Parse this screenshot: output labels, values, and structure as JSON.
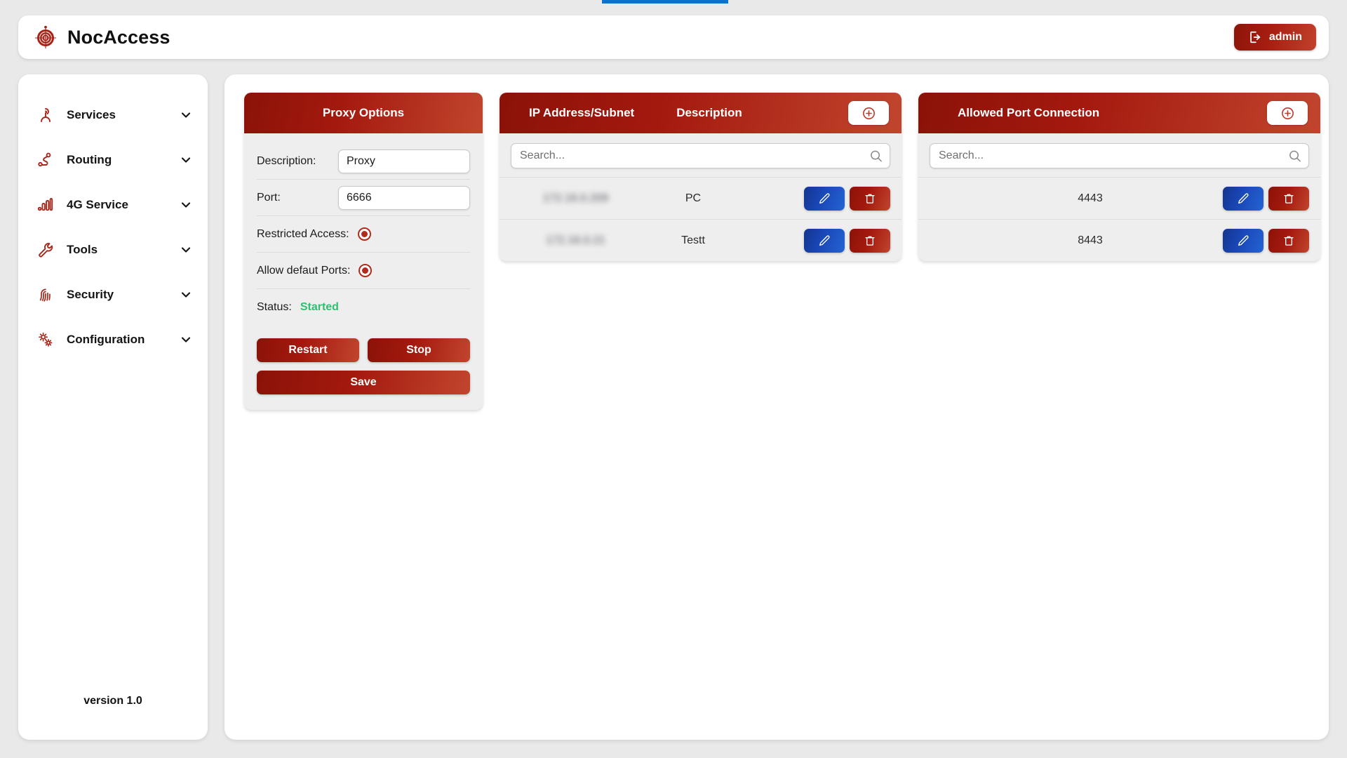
{
  "header": {
    "brand_title": "NocAccess",
    "logo_icon": "radar-target-icon",
    "admin_label": "admin",
    "admin_icon": "logout-icon"
  },
  "sidebar": {
    "items": [
      {
        "label": "Services",
        "icon": "antenna-signal-icon",
        "chevron": "chevron-down-icon"
      },
      {
        "label": "Routing",
        "icon": "route-nodes-icon",
        "chevron": "chevron-down-icon"
      },
      {
        "label": "4G Service",
        "icon": "signal-bars-icon",
        "chevron": "chevron-down-icon"
      },
      {
        "label": "Tools",
        "icon": "wrench-icon",
        "chevron": "chevron-down-icon"
      },
      {
        "label": "Security",
        "icon": "fingerprint-icon",
        "chevron": "chevron-down-icon"
      },
      {
        "label": "Configuration",
        "icon": "gears-icon",
        "chevron": "chevron-down-icon"
      }
    ],
    "version": "version 1.0"
  },
  "proxy_options": {
    "title": "Proxy Options",
    "description_label": "Description:",
    "description_value": "Proxy",
    "description_placeholder": "",
    "port_label": "Port:",
    "port_value": "6666",
    "port_placeholder": "",
    "restricted_access_label": "Restricted Access:",
    "restricted_access_on": true,
    "allow_default_ports_label": "Allow defaut Ports:",
    "allow_default_ports_on": true,
    "status_label": "Status:",
    "status_value": "Started",
    "status_color": "#2fbf71",
    "restart_label": "Restart",
    "stop_label": "Stop",
    "save_label": "Save"
  },
  "ip_panel": {
    "column_ip": "IP Address/Subnet",
    "column_description": "Description",
    "add_icon": "circle-plus-icon",
    "search_placeholder": "Search...",
    "search_value": "",
    "search_icon": "search-icon",
    "rows": [
      {
        "ip": "172.16.0.209",
        "redacted": true,
        "description": "PC",
        "edit_icon": "pencil-icon",
        "delete_icon": "trash-icon"
      },
      {
        "ip": "172.16.0.21",
        "redacted": true,
        "description": "Testt",
        "edit_icon": "pencil-icon",
        "delete_icon": "trash-icon"
      }
    ]
  },
  "port_panel": {
    "title": "Allowed Port Connection",
    "add_icon": "circle-plus-icon",
    "search_placeholder": "Search...",
    "search_value": "",
    "search_icon": "search-icon",
    "rows": [
      {
        "port": "4443",
        "edit_icon": "pencil-icon",
        "delete_icon": "trash-icon"
      },
      {
        "port": "8443",
        "edit_icon": "pencil-icon",
        "delete_icon": "trash-icon"
      }
    ]
  },
  "theme": {
    "brand_red_dark": "#8b1208",
    "brand_red": "#a4190e",
    "brand_red_light": "#c1452e",
    "edit_blue": "#1a48b8",
    "status_green": "#2fbf71",
    "page_bg": "#e9e9e9"
  }
}
